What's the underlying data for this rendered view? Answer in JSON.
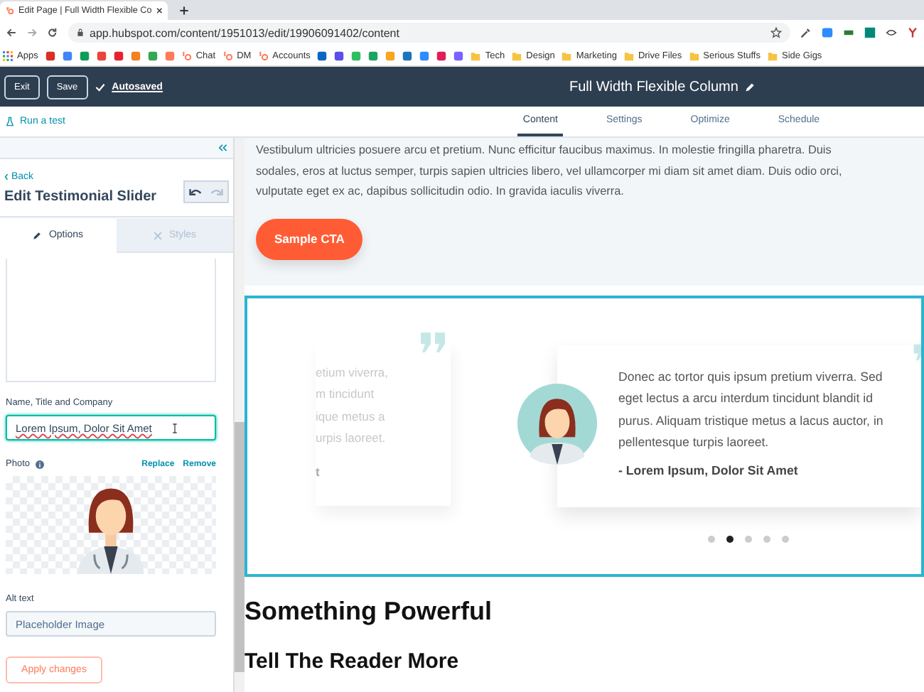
{
  "browser": {
    "tab_title": "Edit Page | Full Width Flexible Co",
    "url": "app.hubspot.com/content/1951013/edit/19906091402/content",
    "bookmarks": [
      {
        "kind": "apps",
        "label": "Apps"
      },
      {
        "kind": "icon",
        "color": "#d93025"
      },
      {
        "kind": "icon",
        "color": "#4285f4"
      },
      {
        "kind": "icon",
        "color": "#0f9d58"
      },
      {
        "kind": "icon",
        "color": "#e8453c"
      },
      {
        "kind": "icon",
        "color": "#e8212e"
      },
      {
        "kind": "icon",
        "color": "#f48024"
      },
      {
        "kind": "icon",
        "color": "#34a853"
      },
      {
        "kind": "icon",
        "color": "#ff7a59"
      },
      {
        "kind": "site",
        "label": "Chat",
        "color": "#ff7a59"
      },
      {
        "kind": "site",
        "label": "DM",
        "color": "#ff7a59"
      },
      {
        "kind": "site",
        "label": "Accounts",
        "color": "#ff7a59"
      },
      {
        "kind": "icon",
        "color": "#0a66c2"
      },
      {
        "kind": "icon",
        "color": "#5b4fe9"
      },
      {
        "kind": "icon",
        "color": "#2dbe60"
      },
      {
        "kind": "icon",
        "color": "#1da462"
      },
      {
        "kind": "icon",
        "color": "#f5a623"
      },
      {
        "kind": "icon",
        "color": "#1b75bb"
      },
      {
        "kind": "icon",
        "color": "#2d8cff"
      },
      {
        "kind": "icon",
        "color": "#e01e5a"
      },
      {
        "kind": "icon",
        "color": "#7b61ff"
      },
      {
        "kind": "folder",
        "label": "Tech"
      },
      {
        "kind": "folder",
        "label": "Design"
      },
      {
        "kind": "folder",
        "label": "Marketing"
      },
      {
        "kind": "folder",
        "label": "Drive Files"
      },
      {
        "kind": "folder",
        "label": "Serious Stuffs"
      },
      {
        "kind": "folder",
        "label": "Side Gigs"
      }
    ]
  },
  "header": {
    "buttons": [
      "Exit",
      "Save"
    ],
    "autosaved": "Autosaved",
    "title": "Full Width Flexible Column"
  },
  "subnav": {
    "run_test": "Run a test",
    "tabs": [
      {
        "label": "Content",
        "selected": true
      },
      {
        "label": "Settings",
        "selected": false
      },
      {
        "label": "Optimize",
        "selected": false
      },
      {
        "label": "Schedule",
        "selected": false
      }
    ]
  },
  "sidebar": {
    "back": "Back",
    "title": "Edit Testimonial Slider",
    "tabs": [
      {
        "label": "Options",
        "selected": true
      },
      {
        "label": "Styles",
        "selected": false
      }
    ],
    "name_label": "Name, Title and Company",
    "name_value": "Lorem Ipsum, Dolor Sit Amet",
    "photo_label": "Photo",
    "photo_links": [
      "Replace",
      "Remove"
    ],
    "alt_label": "Alt text",
    "alt_value": "Placeholder Image",
    "apply": "Apply changes"
  },
  "content": {
    "paragraph": "Vestibulum ultricies posuere arcu et pretium. Nunc efficitur faucibus maximus. In molestie fringilla pharetra. Duis sodales, eros at luctus semper, turpis sapien ultricies libero, vel ullamcorper mi diam sit amet diam. Duis odio orci, vulputate eget ex ac, dapibus sollicitudin odio. In gravida iaculis viverra.",
    "cta": "Sample CTA",
    "slider": {
      "prev_card_lines": [
        "etium viverra,",
        "m tincidunt",
        "ique metus a",
        "urpis laoreet.",
        "t"
      ],
      "quote": "Donec ac tortor quis ipsum pretium viverra. Sed eget lectus a arcu interdum tincidunt blandit id purus. Aliquam tristique metus a lacus auctor, in pellentesque turpis laoreet.",
      "author": "- Lorem Ipsum, Dolor Sit Amet",
      "dots": [
        {
          "selected": false
        },
        {
          "selected": true
        },
        {
          "selected": false
        },
        {
          "selected": false
        },
        {
          "selected": false
        }
      ]
    },
    "heading": "Something Powerful",
    "subheading": "Tell The Reader More"
  }
}
